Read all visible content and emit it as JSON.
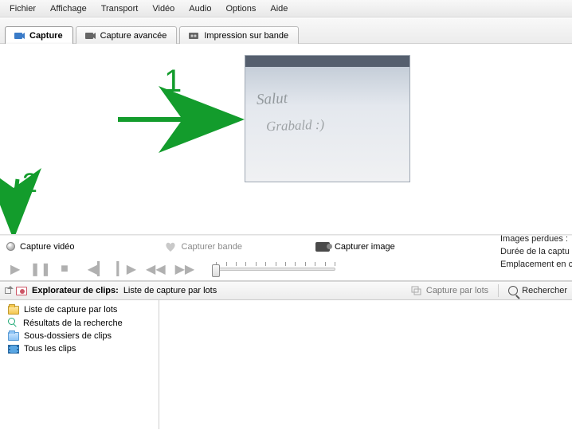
{
  "menu": [
    "Fichier",
    "Affichage",
    "Transport",
    "Vidéo",
    "Audio",
    "Options",
    "Aide"
  ],
  "tabs": [
    {
      "label": "Capture"
    },
    {
      "label": "Capture avancée"
    },
    {
      "label": "Impression sur bande"
    }
  ],
  "annotations": {
    "one": "1",
    "two": "2"
  },
  "preview": {
    "line1": "Salut",
    "line2": "Grabald :)"
  },
  "capture_row": {
    "video": "Capture vidéo",
    "band": "Capturer bande",
    "image": "Capturer image"
  },
  "status": {
    "line1": "Images perdues :",
    "line2": "Durée de la captu",
    "line3": "Emplacement en c"
  },
  "clipbar": {
    "title": "Explorateur de clips:",
    "subtitle": "Liste de capture par lots",
    "batch": "Capture par lots",
    "search": "Rechercher"
  },
  "tree": {
    "n1": "Liste de capture par lots",
    "n2": "Résultats de la recherche",
    "n3": "Sous-dossiers de clips",
    "n4": "Tous les clips"
  }
}
